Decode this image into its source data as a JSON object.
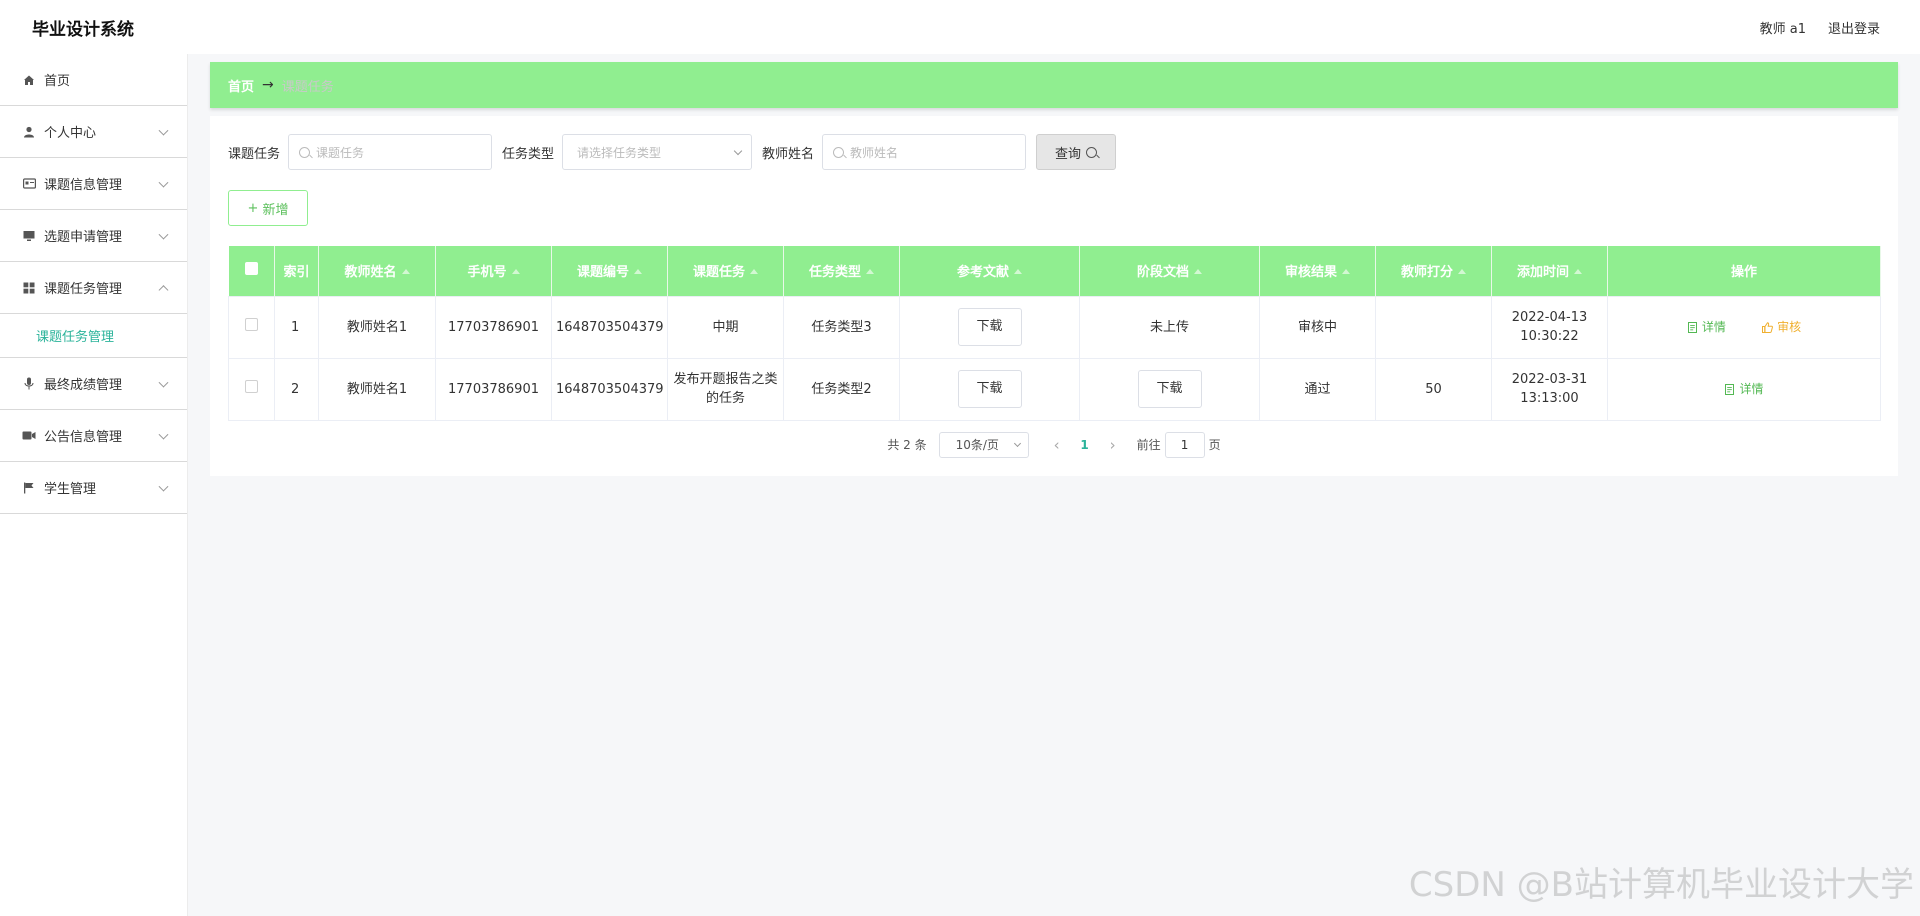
{
  "app": {
    "title": "毕业设计系统"
  },
  "header": {
    "user": "教师 a1",
    "logout": "退出登录"
  },
  "sidebar": {
    "items": [
      {
        "label": "首页",
        "icon": "home-icon"
      },
      {
        "label": "个人中心",
        "icon": "user-icon"
      },
      {
        "label": "课题信息管理",
        "icon": "card-icon"
      },
      {
        "label": "选题申请管理",
        "icon": "monitor-icon"
      },
      {
        "label": "课题任务管理",
        "icon": "grid-icon"
      },
      {
        "label": "最终成绩管理",
        "icon": "mic-icon"
      },
      {
        "label": "公告信息管理",
        "icon": "camera-icon"
      },
      {
        "label": "学生管理",
        "icon": "flag-icon"
      }
    ],
    "sub_active": "课题任务管理"
  },
  "breadcrumb": {
    "home": "首页",
    "arrow": "→",
    "current": "课题任务"
  },
  "search": {
    "task_label": "课题任务",
    "task_placeholder": "课题任务",
    "type_label": "任务类型",
    "type_placeholder": "请选择任务类型",
    "teacher_label": "教师姓名",
    "teacher_placeholder": "教师姓名",
    "query_button": "查询"
  },
  "toolbar": {
    "add_button": "新增"
  },
  "table": {
    "headers": [
      "索引",
      "教师姓名",
      "手机号",
      "课题编号",
      "课题任务",
      "任务类型",
      "参考文献",
      "阶段文档",
      "审核结果",
      "教师打分",
      "添加时间",
      "操作"
    ],
    "rows": [
      {
        "index": "1",
        "teacher": "教师姓名1",
        "phone": "17703786901",
        "code": "1648703504379",
        "task": "中期",
        "type": "任务类型3",
        "ref": "下载",
        "stage": "未上传",
        "audit": "审核中",
        "score": "",
        "time": "2022-04-13 10:30:22",
        "detail": "详情",
        "review": "审核"
      },
      {
        "index": "2",
        "teacher": "教师姓名1",
        "phone": "17703786901",
        "code": "1648703504379",
        "task": "发布开题报告之类的任务",
        "type": "任务类型2",
        "ref": "下载",
        "stage": "下载",
        "audit": "通过",
        "score": "50",
        "time": "2022-03-31 13:13:00",
        "detail": "详情"
      }
    ]
  },
  "pager": {
    "total": "共 2 条",
    "size": "10条/页",
    "prev": "‹",
    "page": "1",
    "next": "›",
    "goto": "前往",
    "goto_value": "1",
    "page_unit": "页"
  },
  "watermark": "CSDN @B站计算机毕业设计大学",
  "colors": {
    "accent": "#90ee90",
    "link": "#2bb39a",
    "detail": "#53b853",
    "audit": "#f0b030"
  }
}
